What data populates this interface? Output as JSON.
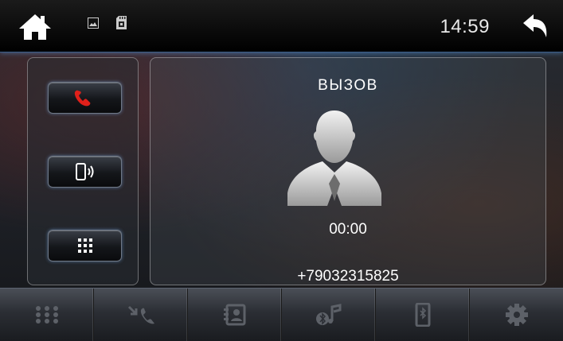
{
  "status_bar": {
    "time": "14:59",
    "icons": [
      "home-icon",
      "image-icon",
      "sd-card-icon",
      "back-arrow-icon"
    ]
  },
  "left_panel": {
    "buttons": [
      "end-call-icon",
      "phone-audio-icon",
      "dialpad-icon"
    ]
  },
  "call": {
    "title": "ВЫЗОВ",
    "timer": "00:00",
    "number": "+79032315825",
    "avatar_icon": "person-silhouette-icon"
  },
  "bottom_nav": {
    "items": [
      "apps-grid-icon",
      "call-log-icon",
      "contacts-icon",
      "bluetooth-music-icon",
      "bluetooth-phone-icon",
      "settings-gear-icon"
    ]
  },
  "colors": {
    "accent_blue": "#3a5d88",
    "end_call_red": "#e0201a"
  }
}
